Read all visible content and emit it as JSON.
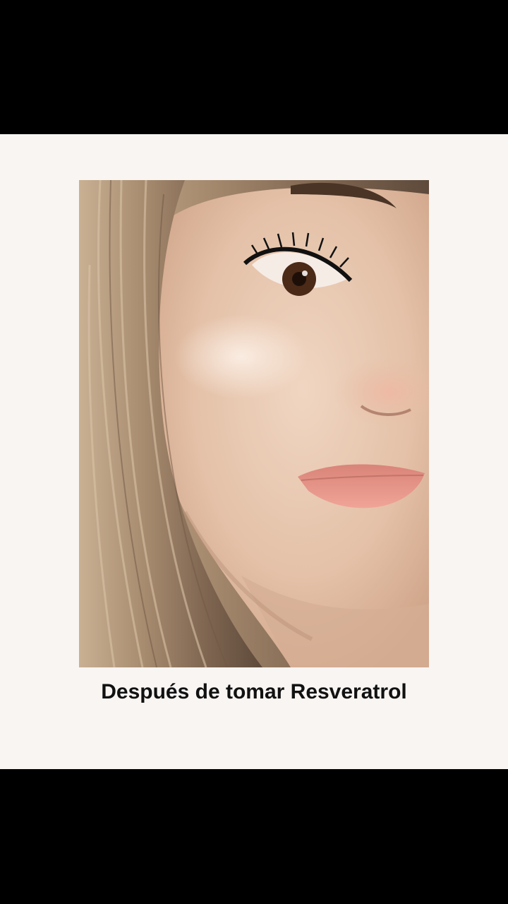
{
  "caption": "Después de tomar Resveratrol",
  "colors": {
    "frame": "#000000",
    "card": "#f8f5f3",
    "caption_text": "#111111",
    "skin": "#e7c8b0",
    "hair": "#a98d72",
    "lips": "#e9968a",
    "iris": "#4b2a17"
  },
  "photo": {
    "subject": "close-up portrait"
  }
}
